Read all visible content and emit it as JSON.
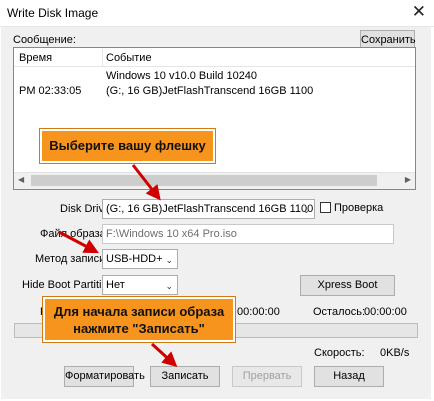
{
  "window": {
    "title": "Write Disk Image",
    "close_glyph": "✕"
  },
  "log": {
    "label": "Сообщение:",
    "save_button": "Сохранить",
    "columns": [
      "Время",
      "Событие"
    ],
    "rows": [
      {
        "time": "",
        "event": "Windows 10 v10.0 Build 10240"
      },
      {
        "time": "PM 02:33:05",
        "event": "(G:, 16 GB)JetFlashTranscend 16GB  1100"
      }
    ]
  },
  "form": {
    "disk_drive_label": "Disk Drive:",
    "disk_drive_value": "(G:, 16 GB)JetFlashTranscend 16GB  1100",
    "verify_label": "Проверка",
    "verify_checked": false,
    "image_file_label": "Файл образа:",
    "image_file_value": "F:\\Windows 10 x64 Pro.iso",
    "write_method_label": "Метод записи:",
    "write_method_value": "USB-HDD+",
    "hide_boot_label": "Hide Boot Partition:",
    "hide_boot_value": "Нет",
    "xpress_boot_button": "Xpress Boot"
  },
  "progress": {
    "elapsed_time": "00:00:00",
    "remaining_label": "Осталось:",
    "remaining_time": "00:00:00",
    "speed_label": "Скорость:",
    "speed_value": "0KB/s",
    "fraction": 0
  },
  "buttons": {
    "format": "Форматировать",
    "write": "Записать",
    "abort": "Прервать",
    "back": "Назад"
  },
  "callouts": {
    "select_drive": "Выберите вашу флешку",
    "start_write": "Для начала записи образа нажмите \"Записать\""
  },
  "colors": {
    "callout_bg": "#f7941d",
    "arrow": "#d00000"
  }
}
